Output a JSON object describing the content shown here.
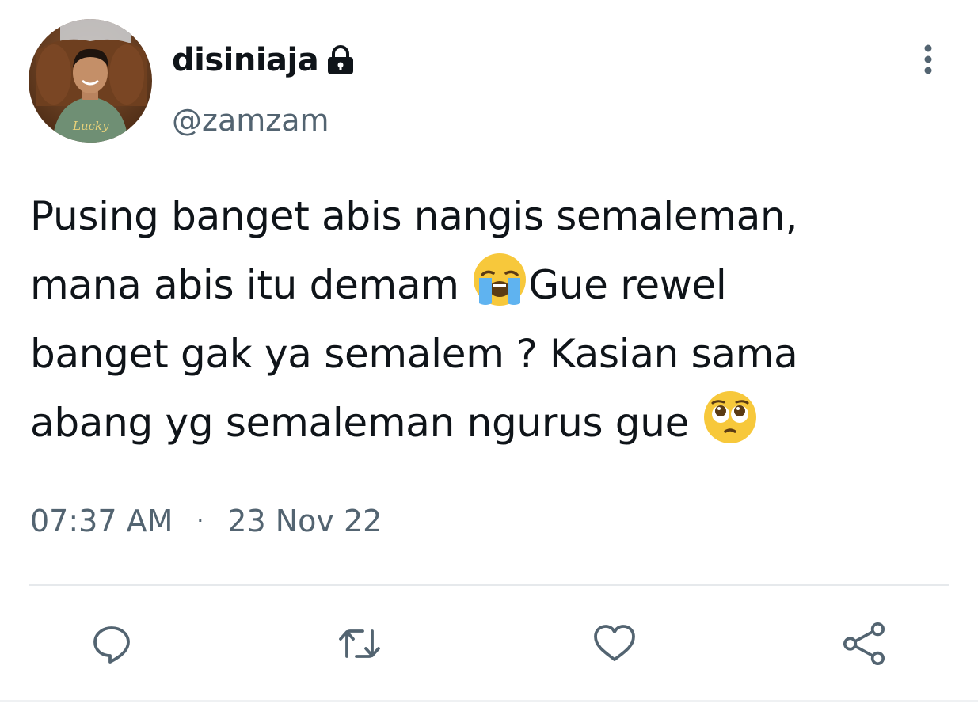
{
  "tweet": {
    "display_name": "disiniaja",
    "handle": "@zamzam",
    "lines": [
      "Pusing banget abis nangis semaleman,",
      "mana abis itu demam ",
      "Gue rewel",
      "banget gak ya semalem ? Kasian sama",
      "abang yg semaleman ngurus gue "
    ],
    "emojis": [
      "loudly-crying-face",
      "pleading-face"
    ],
    "time": "07:37 AM",
    "separator": "·",
    "date": "23 Nov 22"
  },
  "header": {
    "avatar_text": "Lucky",
    "icons": {
      "lock": "lock-icon",
      "more": "more-vertical-icon"
    }
  },
  "actions": {
    "icons": [
      "reply-icon",
      "retweet-icon",
      "like-icon",
      "share-icon"
    ]
  },
  "colors": {
    "text_primary": "#0f1419",
    "text_secondary": "#536471",
    "divider": "#e6e9ec"
  }
}
